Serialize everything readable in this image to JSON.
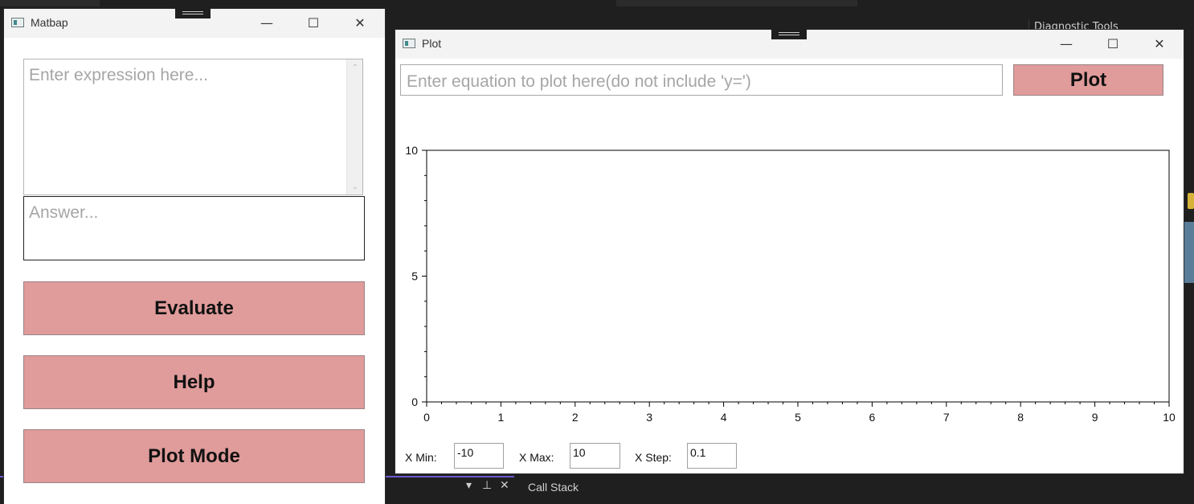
{
  "matbap_window": {
    "title": "Matbap",
    "expression_placeholder": "Enter expression here...",
    "answer_placeholder": "Answer...",
    "buttons": {
      "evaluate": "Evaluate",
      "help": "Help",
      "plot_mode": "Plot Mode"
    }
  },
  "plot_window": {
    "title": "Plot",
    "equation_placeholder": "Enter equation to plot here(do not include 'y=')",
    "plot_button": "Plot",
    "x_min_label": "X Min:",
    "x_min_value": "-10",
    "x_max_label": "X Max:",
    "x_max_value": "10",
    "x_step_label": "X Step:",
    "x_step_value": "0.1"
  },
  "chart_data": {
    "type": "line",
    "series": [],
    "xlim": [
      0,
      10
    ],
    "ylim": [
      0,
      10
    ],
    "x_ticks": [
      "0",
      "1",
      "2",
      "3",
      "4",
      "5",
      "6",
      "7",
      "8",
      "9",
      "10"
    ],
    "y_ticks": [
      "0",
      "5",
      "10"
    ],
    "grid": false
  },
  "background": {
    "diagnostic_panel_title": "Diagnostic Tools",
    "call_stack_label": "Call Stack"
  },
  "window_controls": {
    "minimize_icon": "minimize-icon",
    "maximize_icon": "maximize-icon",
    "close_icon": "close-icon"
  },
  "colors": {
    "button_fill": "#e09b9b",
    "ide_background": "#1f1f1f"
  }
}
